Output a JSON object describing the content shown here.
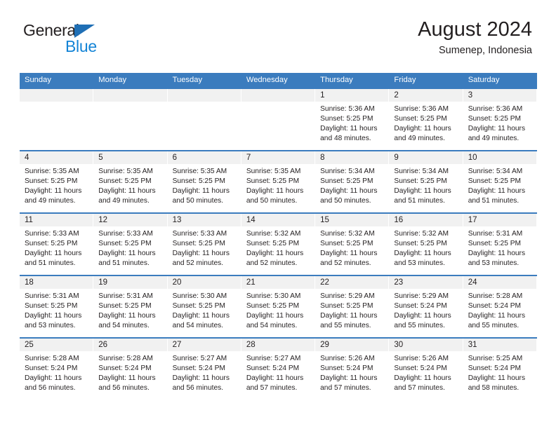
{
  "brand": {
    "name_top": "General",
    "name_bottom": "Blue",
    "accent_color": "#1484d6",
    "triangle_color": "#1f6fb5"
  },
  "header": {
    "title": "August 2024",
    "subtitle": "Sumenep, Indonesia"
  },
  "calendar": {
    "header_bg": "#3b7cbe",
    "daynum_bg": "#f1f1f1",
    "weekdays": [
      "Sunday",
      "Monday",
      "Tuesday",
      "Wednesday",
      "Thursday",
      "Friday",
      "Saturday"
    ],
    "weeks": [
      [
        {
          "day": "",
          "sunrise": "",
          "sunset": "",
          "daylight_line1": "",
          "daylight_line2": ""
        },
        {
          "day": "",
          "sunrise": "",
          "sunset": "",
          "daylight_line1": "",
          "daylight_line2": ""
        },
        {
          "day": "",
          "sunrise": "",
          "sunset": "",
          "daylight_line1": "",
          "daylight_line2": ""
        },
        {
          "day": "",
          "sunrise": "",
          "sunset": "",
          "daylight_line1": "",
          "daylight_line2": ""
        },
        {
          "day": "1",
          "sunrise": "Sunrise: 5:36 AM",
          "sunset": "Sunset: 5:25 PM",
          "daylight_line1": "Daylight: 11 hours",
          "daylight_line2": "and 48 minutes."
        },
        {
          "day": "2",
          "sunrise": "Sunrise: 5:36 AM",
          "sunset": "Sunset: 5:25 PM",
          "daylight_line1": "Daylight: 11 hours",
          "daylight_line2": "and 49 minutes."
        },
        {
          "day": "3",
          "sunrise": "Sunrise: 5:36 AM",
          "sunset": "Sunset: 5:25 PM",
          "daylight_line1": "Daylight: 11 hours",
          "daylight_line2": "and 49 minutes."
        }
      ],
      [
        {
          "day": "4",
          "sunrise": "Sunrise: 5:35 AM",
          "sunset": "Sunset: 5:25 PM",
          "daylight_line1": "Daylight: 11 hours",
          "daylight_line2": "and 49 minutes."
        },
        {
          "day": "5",
          "sunrise": "Sunrise: 5:35 AM",
          "sunset": "Sunset: 5:25 PM",
          "daylight_line1": "Daylight: 11 hours",
          "daylight_line2": "and 49 minutes."
        },
        {
          "day": "6",
          "sunrise": "Sunrise: 5:35 AM",
          "sunset": "Sunset: 5:25 PM",
          "daylight_line1": "Daylight: 11 hours",
          "daylight_line2": "and 50 minutes."
        },
        {
          "day": "7",
          "sunrise": "Sunrise: 5:35 AM",
          "sunset": "Sunset: 5:25 PM",
          "daylight_line1": "Daylight: 11 hours",
          "daylight_line2": "and 50 minutes."
        },
        {
          "day": "8",
          "sunrise": "Sunrise: 5:34 AM",
          "sunset": "Sunset: 5:25 PM",
          "daylight_line1": "Daylight: 11 hours",
          "daylight_line2": "and 50 minutes."
        },
        {
          "day": "9",
          "sunrise": "Sunrise: 5:34 AM",
          "sunset": "Sunset: 5:25 PM",
          "daylight_line1": "Daylight: 11 hours",
          "daylight_line2": "and 51 minutes."
        },
        {
          "day": "10",
          "sunrise": "Sunrise: 5:34 AM",
          "sunset": "Sunset: 5:25 PM",
          "daylight_line1": "Daylight: 11 hours",
          "daylight_line2": "and 51 minutes."
        }
      ],
      [
        {
          "day": "11",
          "sunrise": "Sunrise: 5:33 AM",
          "sunset": "Sunset: 5:25 PM",
          "daylight_line1": "Daylight: 11 hours",
          "daylight_line2": "and 51 minutes."
        },
        {
          "day": "12",
          "sunrise": "Sunrise: 5:33 AM",
          "sunset": "Sunset: 5:25 PM",
          "daylight_line1": "Daylight: 11 hours",
          "daylight_line2": "and 51 minutes."
        },
        {
          "day": "13",
          "sunrise": "Sunrise: 5:33 AM",
          "sunset": "Sunset: 5:25 PM",
          "daylight_line1": "Daylight: 11 hours",
          "daylight_line2": "and 52 minutes."
        },
        {
          "day": "14",
          "sunrise": "Sunrise: 5:32 AM",
          "sunset": "Sunset: 5:25 PM",
          "daylight_line1": "Daylight: 11 hours",
          "daylight_line2": "and 52 minutes."
        },
        {
          "day": "15",
          "sunrise": "Sunrise: 5:32 AM",
          "sunset": "Sunset: 5:25 PM",
          "daylight_line1": "Daylight: 11 hours",
          "daylight_line2": "and 52 minutes."
        },
        {
          "day": "16",
          "sunrise": "Sunrise: 5:32 AM",
          "sunset": "Sunset: 5:25 PM",
          "daylight_line1": "Daylight: 11 hours",
          "daylight_line2": "and 53 minutes."
        },
        {
          "day": "17",
          "sunrise": "Sunrise: 5:31 AM",
          "sunset": "Sunset: 5:25 PM",
          "daylight_line1": "Daylight: 11 hours",
          "daylight_line2": "and 53 minutes."
        }
      ],
      [
        {
          "day": "18",
          "sunrise": "Sunrise: 5:31 AM",
          "sunset": "Sunset: 5:25 PM",
          "daylight_line1": "Daylight: 11 hours",
          "daylight_line2": "and 53 minutes."
        },
        {
          "day": "19",
          "sunrise": "Sunrise: 5:31 AM",
          "sunset": "Sunset: 5:25 PM",
          "daylight_line1": "Daylight: 11 hours",
          "daylight_line2": "and 54 minutes."
        },
        {
          "day": "20",
          "sunrise": "Sunrise: 5:30 AM",
          "sunset": "Sunset: 5:25 PM",
          "daylight_line1": "Daylight: 11 hours",
          "daylight_line2": "and 54 minutes."
        },
        {
          "day": "21",
          "sunrise": "Sunrise: 5:30 AM",
          "sunset": "Sunset: 5:25 PM",
          "daylight_line1": "Daylight: 11 hours",
          "daylight_line2": "and 54 minutes."
        },
        {
          "day": "22",
          "sunrise": "Sunrise: 5:29 AM",
          "sunset": "Sunset: 5:25 PM",
          "daylight_line1": "Daylight: 11 hours",
          "daylight_line2": "and 55 minutes."
        },
        {
          "day": "23",
          "sunrise": "Sunrise: 5:29 AM",
          "sunset": "Sunset: 5:24 PM",
          "daylight_line1": "Daylight: 11 hours",
          "daylight_line2": "and 55 minutes."
        },
        {
          "day": "24",
          "sunrise": "Sunrise: 5:28 AM",
          "sunset": "Sunset: 5:24 PM",
          "daylight_line1": "Daylight: 11 hours",
          "daylight_line2": "and 55 minutes."
        }
      ],
      [
        {
          "day": "25",
          "sunrise": "Sunrise: 5:28 AM",
          "sunset": "Sunset: 5:24 PM",
          "daylight_line1": "Daylight: 11 hours",
          "daylight_line2": "and 56 minutes."
        },
        {
          "day": "26",
          "sunrise": "Sunrise: 5:28 AM",
          "sunset": "Sunset: 5:24 PM",
          "daylight_line1": "Daylight: 11 hours",
          "daylight_line2": "and 56 minutes."
        },
        {
          "day": "27",
          "sunrise": "Sunrise: 5:27 AM",
          "sunset": "Sunset: 5:24 PM",
          "daylight_line1": "Daylight: 11 hours",
          "daylight_line2": "and 56 minutes."
        },
        {
          "day": "28",
          "sunrise": "Sunrise: 5:27 AM",
          "sunset": "Sunset: 5:24 PM",
          "daylight_line1": "Daylight: 11 hours",
          "daylight_line2": "and 57 minutes."
        },
        {
          "day": "29",
          "sunrise": "Sunrise: 5:26 AM",
          "sunset": "Sunset: 5:24 PM",
          "daylight_line1": "Daylight: 11 hours",
          "daylight_line2": "and 57 minutes."
        },
        {
          "day": "30",
          "sunrise": "Sunrise: 5:26 AM",
          "sunset": "Sunset: 5:24 PM",
          "daylight_line1": "Daylight: 11 hours",
          "daylight_line2": "and 57 minutes."
        },
        {
          "day": "31",
          "sunrise": "Sunrise: 5:25 AM",
          "sunset": "Sunset: 5:24 PM",
          "daylight_line1": "Daylight: 11 hours",
          "daylight_line2": "and 58 minutes."
        }
      ]
    ]
  }
}
